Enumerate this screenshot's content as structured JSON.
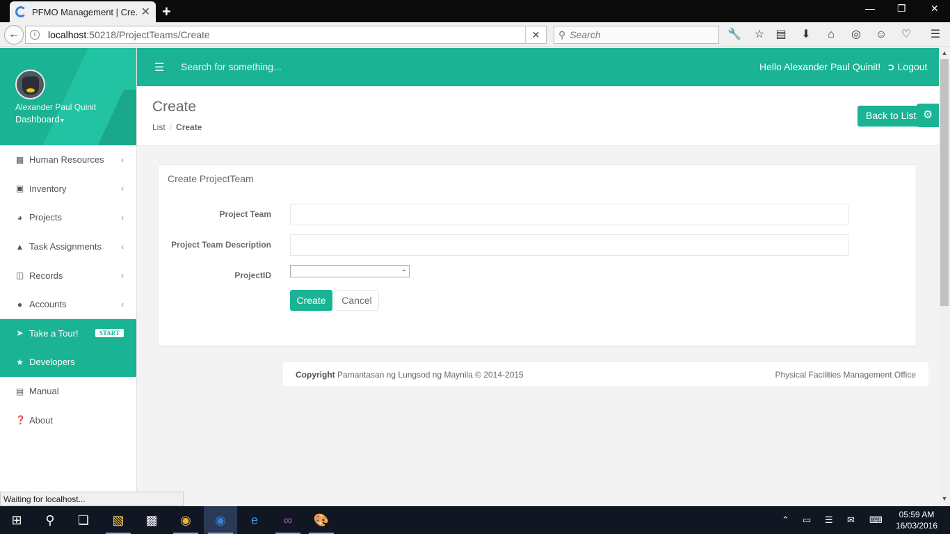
{
  "browser": {
    "tab_title": "PFMO Management | Cre...",
    "tab_close": "✕",
    "new_tab": "+",
    "url_host": "localhost",
    "url_path": ":50218/ProjectTeams/Create",
    "search_placeholder": "Search",
    "status_text": "Waiting for localhost..."
  },
  "profile": {
    "name": "Alexander Paul Quinit",
    "role": "Dashboard"
  },
  "sidebar": {
    "items": [
      {
        "label": "Human Resources",
        "icon": "sitemap-icon"
      },
      {
        "label": "Inventory",
        "icon": "cart-icon"
      },
      {
        "label": "Projects",
        "icon": "pie-chart-icon"
      },
      {
        "label": "Task Assignments",
        "icon": "bell-icon"
      },
      {
        "label": "Records",
        "icon": "folder-icon"
      },
      {
        "label": "Accounts",
        "icon": "users-icon"
      },
      {
        "label": "Take a Tour!",
        "icon": "plane-icon",
        "badge": "START"
      },
      {
        "label": "Developers",
        "icon": "star-icon"
      },
      {
        "label": "Manual",
        "icon": "file-icon"
      },
      {
        "label": "About",
        "icon": "question-icon"
      }
    ]
  },
  "topnav": {
    "search": "Search for something...",
    "greeting": "Hello Alexander Paul Quinit!",
    "logout": "Logout"
  },
  "heading": {
    "title": "Create",
    "breadcrumb_list": "List",
    "breadcrumb_current": "Create",
    "back_to_list": "Back to List"
  },
  "form": {
    "title": "Create ProjectTeam",
    "project_team_label": "Project Team",
    "project_team_value": "",
    "description_label": "Project Team Description",
    "description_value": "",
    "project_id_label": "ProjectID",
    "project_id_value": "",
    "create_label": "Create",
    "cancel_label": "Cancel"
  },
  "footer": {
    "copyright_bold": "Copyright",
    "copyright_text": "Pamantasan ng Lungsod ng Maynila © 2014-2015",
    "right_text": "Physical Facilities Management Office"
  },
  "clock": {
    "time": "05:59 AM",
    "date": "16/03/2016"
  },
  "colors": {
    "accent": "#1ab394"
  }
}
